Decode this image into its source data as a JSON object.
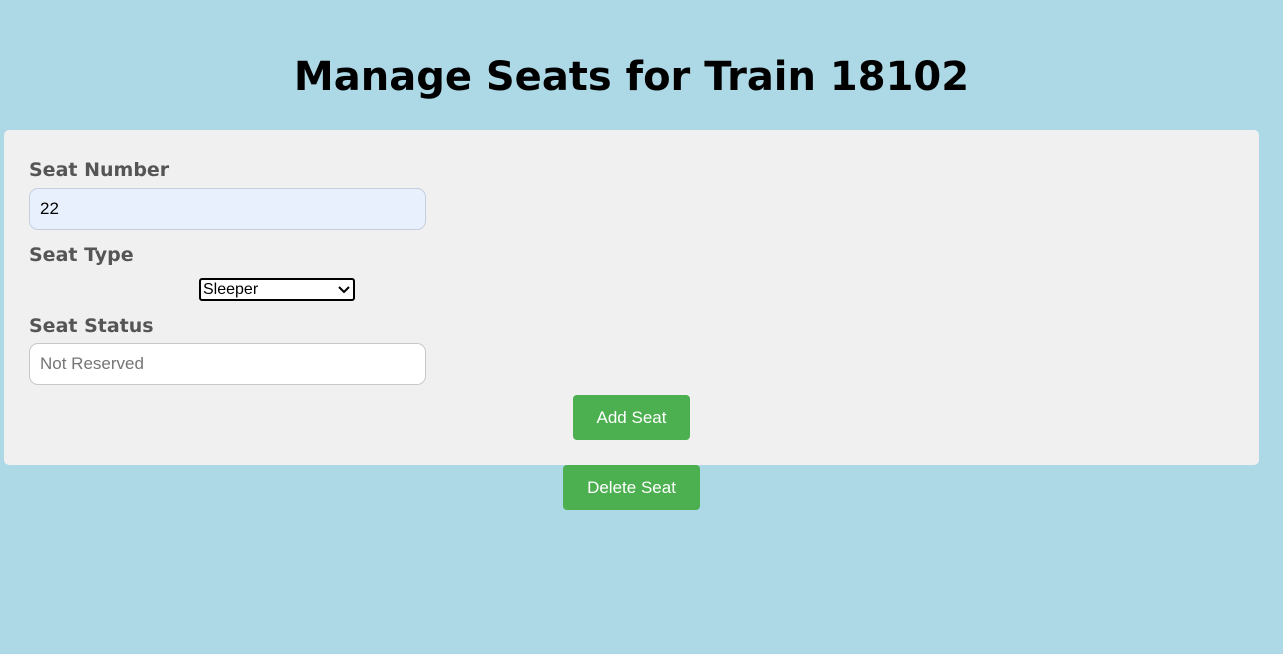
{
  "page": {
    "title": "Manage Seats for Train 18102"
  },
  "form": {
    "seat_number": {
      "label": "Seat Number",
      "value": "22"
    },
    "seat_type": {
      "label": "Seat Type",
      "selected": "Sleeper"
    },
    "seat_status": {
      "label": "Seat Status",
      "value": "",
      "placeholder": "Not Reserved"
    },
    "add_button_label": "Add Seat"
  },
  "actions": {
    "delete_button_label": "Delete Seat"
  },
  "colors": {
    "background": "#add8e6",
    "card": "#f0f0f0",
    "button": "#4caf50",
    "autofill": "#e8f0fe"
  },
  "icons": {
    "select_arrow": "chevron-down-icon"
  }
}
